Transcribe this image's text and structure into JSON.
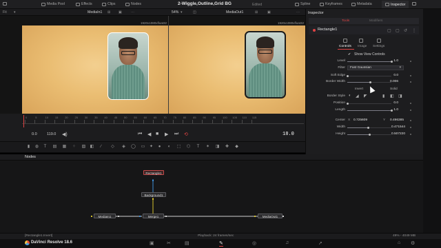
{
  "toolbar": {
    "left_items": [
      {
        "icon": "media-pool-icon",
        "label": "Media Pool"
      },
      {
        "icon": "effects-icon",
        "label": "Effects"
      },
      {
        "icon": "clips-icon",
        "label": "Clips"
      },
      {
        "icon": "nodes-icon",
        "label": "Nodes"
      }
    ],
    "project_title": "2-Wiggle,Outline,Grid BG",
    "edited": "Edited",
    "right_items": [
      {
        "icon": "spline-icon",
        "label": "Spline"
      },
      {
        "icon": "keyframes-icon",
        "label": "Keyframes"
      },
      {
        "icon": "metadata-icon",
        "label": "Metadata"
      },
      {
        "icon": "inspector-icon",
        "label": "Inspector"
      }
    ]
  },
  "viewer_header": {
    "fit": "Fit",
    "left_source": "MediaIn1",
    "zoom": "54%",
    "right_source": "MediaOut1",
    "left_resolution": "1920x1080xfloat32",
    "right_resolution": "1920x1080xfloat32"
  },
  "ruler": {
    "ticks": [
      "0",
      "5",
      "10",
      "15",
      "20",
      "25",
      "30",
      "35",
      "40",
      "45",
      "50",
      "55",
      "60",
      "65",
      "70",
      "75",
      "80",
      "85",
      "90",
      "95",
      "100",
      "105",
      "110",
      "115"
    ]
  },
  "transport": {
    "start": "0.0",
    "end": "119.0",
    "current_frame": "18.0"
  },
  "nodes_panel": {
    "title": "Nodes",
    "nodes": {
      "rectangle": "Rectangle1",
      "background": "Background1",
      "media_in": "MediaIn1",
      "merge": "Merge1",
      "media_out": "MediaOut1"
    }
  },
  "status": {
    "left": "[Rectangle1.Invert]",
    "playback": "Playback: 24 frames/sec",
    "memory": "49% - 4049 MB"
  },
  "app": {
    "name": "DaVinci Resolve 18.6"
  },
  "inspector": {
    "title": "Inspector",
    "tabs": [
      "Tools",
      "Modifiers"
    ],
    "tool_name": "Rectangle1",
    "sub_tabs": [
      "Controls",
      "Image",
      "Settings"
    ],
    "show_view_controls": "Show View Controls",
    "params": [
      {
        "label": "Level",
        "value": "1.0",
        "fraction": 1.0
      },
      {
        "label": "Filter",
        "value": "Fast Gaussian"
      },
      {
        "label": "Soft Edge",
        "value": "0.0",
        "fraction": 0.0
      },
      {
        "label": "Border Width",
        "value": "0.006",
        "fraction": 0.52
      }
    ],
    "invert_label": "Invert",
    "solid_label": "Solid",
    "border_style_label": "Border Style",
    "params2": [
      {
        "label": "Position",
        "value": "0.0",
        "fraction": 0.0
      },
      {
        "label": "Length",
        "value": "1.0",
        "fraction": 1.0
      }
    ],
    "center": {
      "label": "Center",
      "x_label": "X",
      "x": "0.725609",
      "y_label": "Y",
      "y": "0.496385"
    },
    "params3": [
      {
        "label": "Width",
        "value": "0.471544",
        "fraction": 0.47
      },
      {
        "label": "Height",
        "value": "0.507220",
        "fraction": 0.5
      }
    ]
  },
  "colors": {
    "accent": "#e04343",
    "node_link_yellow": "#d6c12d",
    "node_link_blue": "#3f8fd6",
    "node_link_white": "#d0d0d0"
  }
}
